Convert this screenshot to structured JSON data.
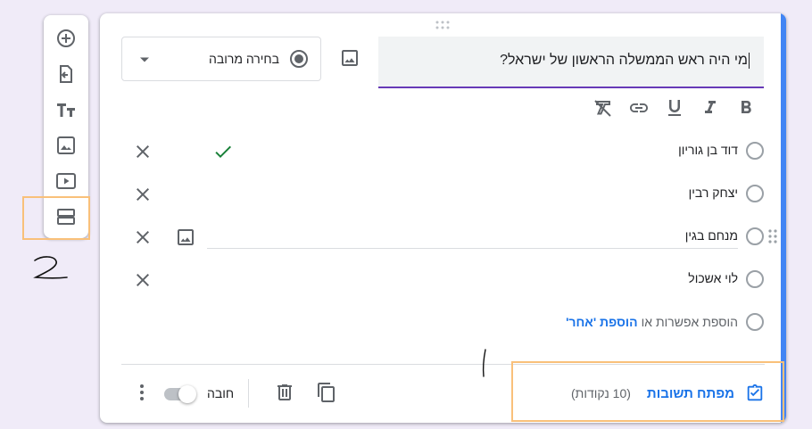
{
  "side_toolbar": {
    "icons": [
      "add-question-icon",
      "import-questions-icon",
      "add-title-icon",
      "add-image-icon",
      "add-video-icon",
      "add-section-icon"
    ]
  },
  "question": {
    "type_label": "בחירה מרובה",
    "title": "מי היה ראש הממשלה הראשון של ישראל?",
    "format_icons": [
      "bold-icon",
      "italic-icon",
      "underline-icon",
      "link-icon",
      "clear-format-icon"
    ]
  },
  "options": [
    {
      "text": "דוד בן גוריון",
      "correct": true
    },
    {
      "text": "יצחק רבין",
      "correct": false
    },
    {
      "text": "מנחם בגין",
      "correct": false
    },
    {
      "text": "לוי אשכול",
      "correct": false
    }
  ],
  "add_option": {
    "add_label": "הוספת אפשרות",
    "or_label": "או",
    "add_other_label": "הוספת 'אחר'"
  },
  "footer": {
    "answer_key_label": "מפתח תשובות",
    "points_label": "(10 נקודות)",
    "required_label": "חובה",
    "required_on": false
  },
  "handwriting": {
    "side_mark": "2"
  },
  "colors": {
    "background": "#f0ebf8",
    "accent_blue": "#4285f4",
    "primary_purple": "#673ab7",
    "link_blue": "#1a73e8",
    "check_green": "#188038",
    "highlight_orange": "#f9c07a"
  }
}
